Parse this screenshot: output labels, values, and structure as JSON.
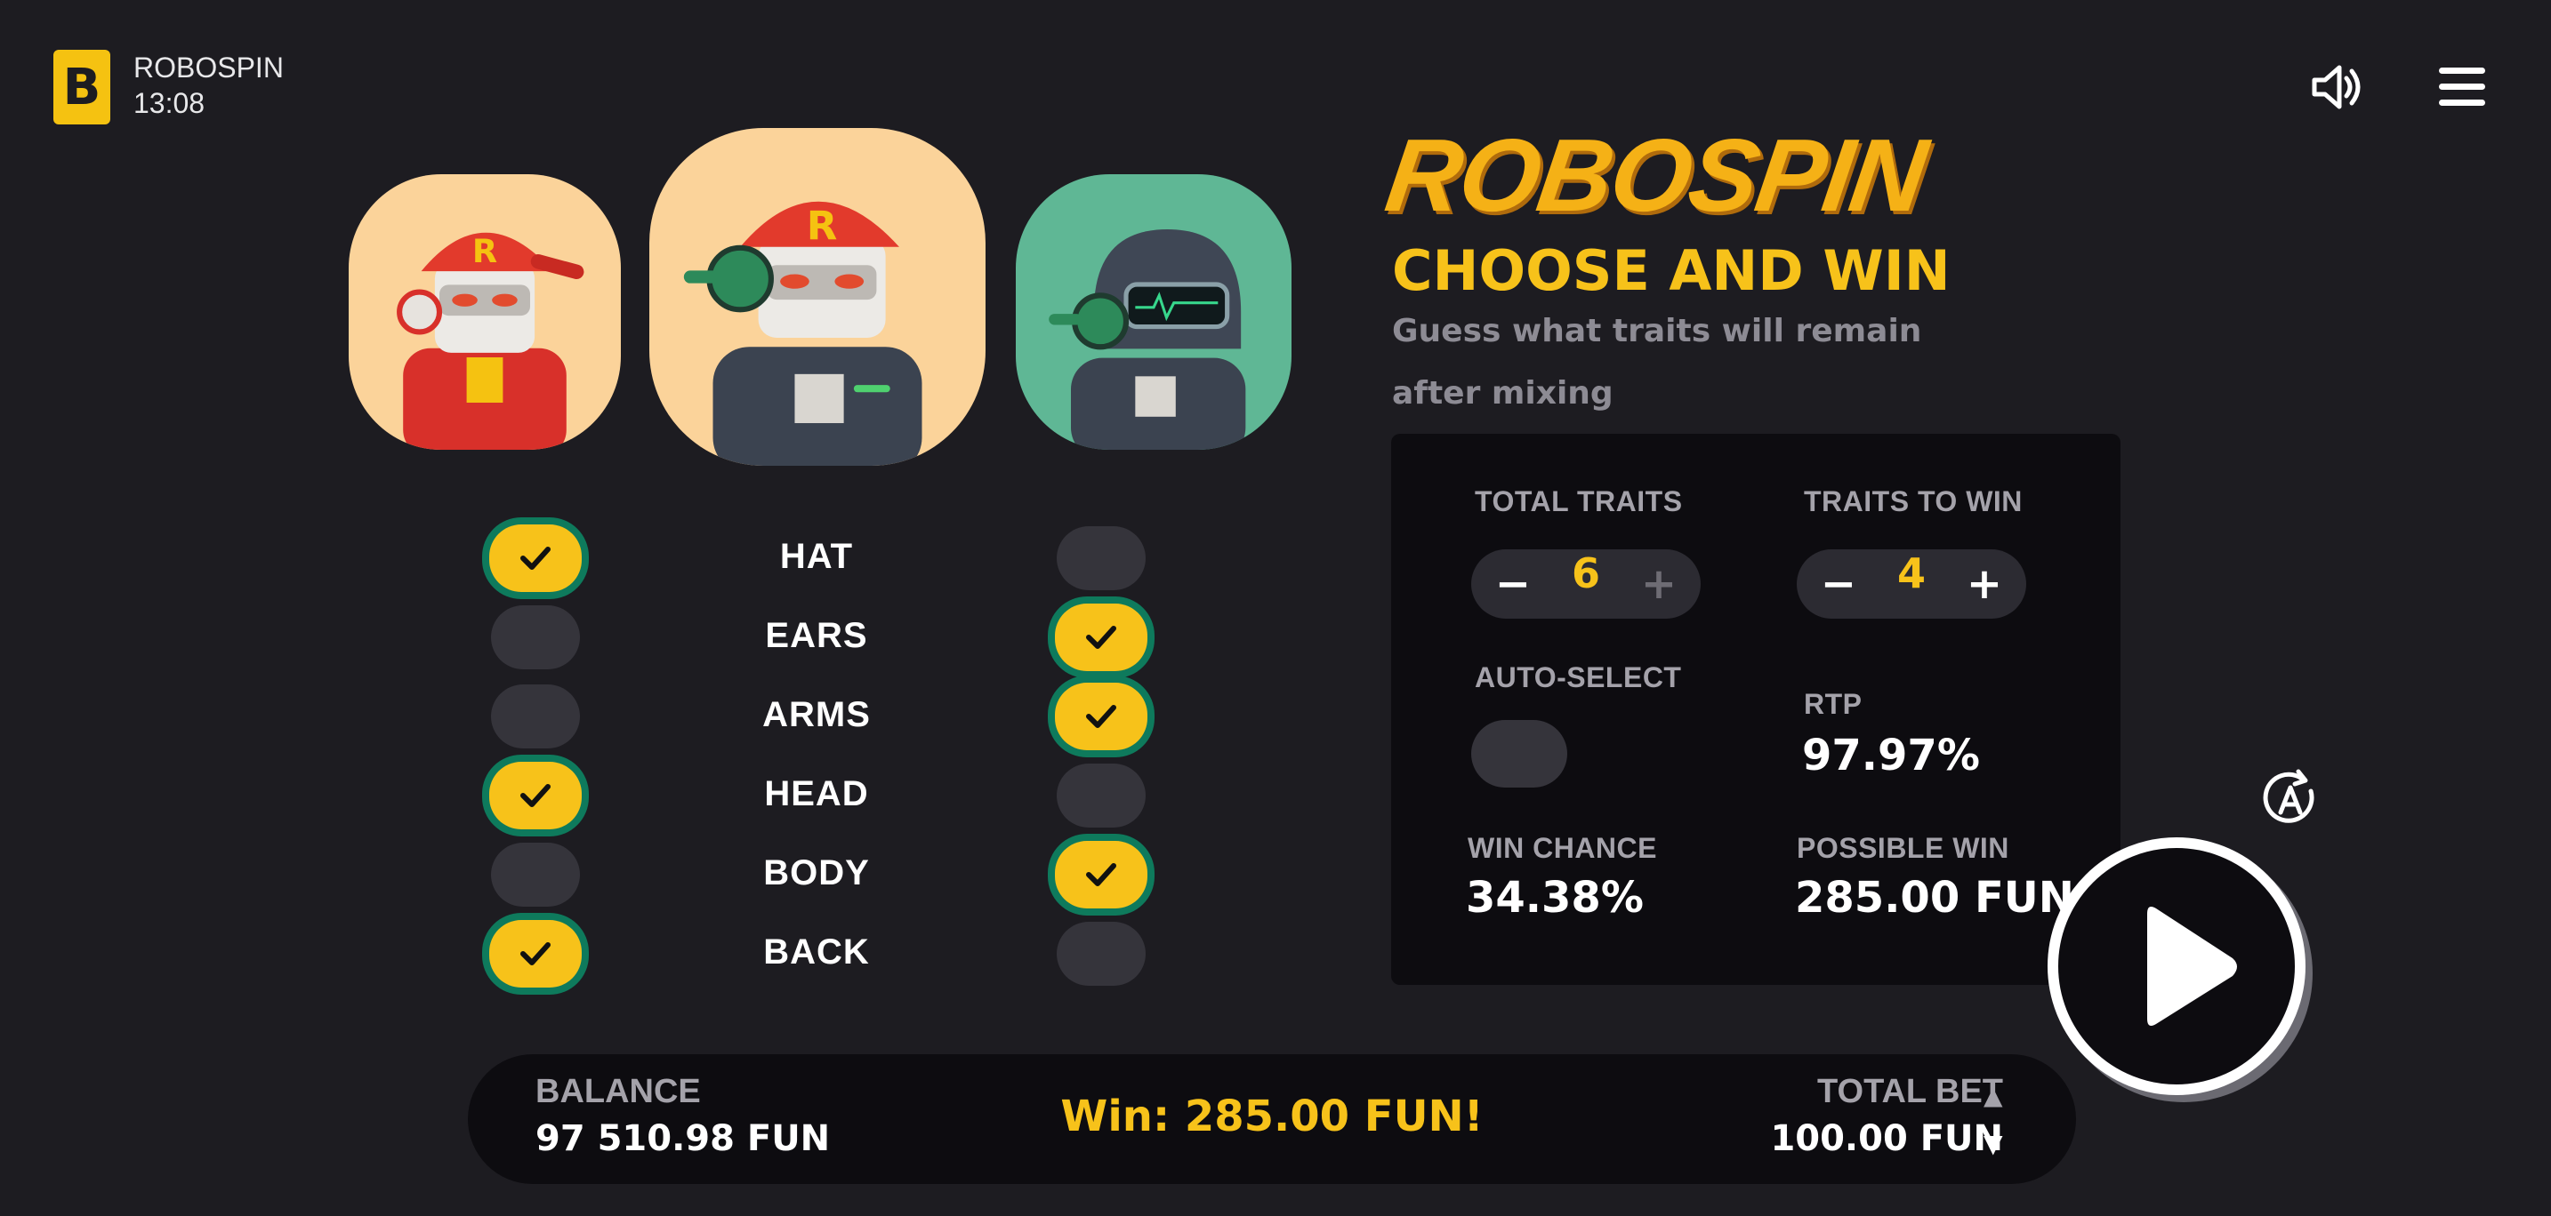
{
  "header": {
    "logo_letter": "B",
    "game_name": "ROBOSPIN",
    "time": "13:08"
  },
  "icons": {
    "sound": "speaker-icon",
    "menu": "hamburger-menu-icon",
    "auto": "auto-spin-icon",
    "play": "play-icon",
    "check": "checkmark-icon"
  },
  "colors": {
    "background": "#1d1c21",
    "accent": "#f7c21a",
    "toggle_ring": "#0e7a5c",
    "panel": "#0d0c10"
  },
  "hero": {
    "brand": "ROBOSPIN",
    "subtitle": "CHOOSE AND WIN",
    "description": "Guess what traits will remain after mixing"
  },
  "traits": [
    {
      "label": "HAT",
      "left_selected": true,
      "right_selected": false
    },
    {
      "label": "EARS",
      "left_selected": false,
      "right_selected": true
    },
    {
      "label": "ARMS",
      "left_selected": false,
      "right_selected": true
    },
    {
      "label": "HEAD",
      "left_selected": true,
      "right_selected": false
    },
    {
      "label": "BODY",
      "left_selected": false,
      "right_selected": true
    },
    {
      "label": "BACK",
      "left_selected": true,
      "right_selected": false
    }
  ],
  "panel": {
    "total_traits_label": "TOTAL TRAITS",
    "total_traits_value": "6",
    "traits_to_win_label": "TRAITS TO WIN",
    "traits_to_win_value": "4",
    "minus": "−",
    "plus": "+",
    "auto_select_label": "AUTO-SELECT",
    "auto_select_on": false,
    "rtp_label": "RTP",
    "rtp_value": "97.97%",
    "win_chance_label": "WIN CHANCE",
    "win_chance_value": "34.38%",
    "possible_win_label": "POSSIBLE WIN",
    "possible_win_value": "285.00 FUN"
  },
  "footer": {
    "balance_label": "BALANCE",
    "balance_value": "97 510.98 FUN",
    "win_message": "Win: 285.00 FUN!",
    "total_bet_label": "TOTAL BET",
    "total_bet_value": "100.00 FUN",
    "bet_up": "▲",
    "bet_down": "▼"
  }
}
